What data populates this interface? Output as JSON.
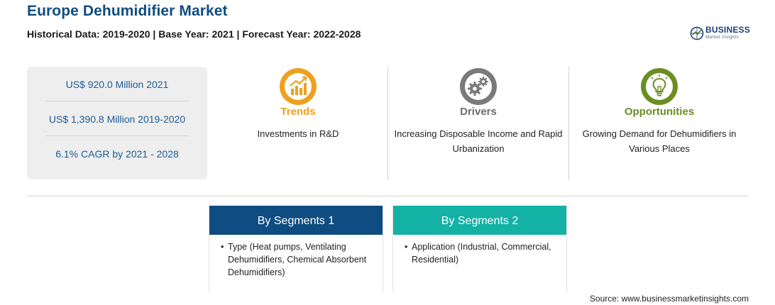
{
  "header": {
    "title": "Europe Dehumidifier Market",
    "subtitle": "Historical Data: 2019-2020 | Base Year: 2021 | Forecast Year: 2022-2028"
  },
  "logo": {
    "name": "BUSINESS",
    "tagline": "Market Insights",
    "icon": "globe-logo-icon"
  },
  "stats": [
    "US$ 920.0 Million 2021",
    "US$ 1,390.8 Million 2019-2020",
    "6.1% CAGR by 2021 - 2028"
  ],
  "columns": {
    "trends": {
      "title": "Trends",
      "text": "Investments in R&D",
      "icon": "trend-chart-icon",
      "color": "#f0a01e"
    },
    "drivers": {
      "title": "Drivers",
      "text": "Increasing Disposable Income and Rapid Urbanization",
      "icon": "gears-icon",
      "color": "#6d6d6d"
    },
    "opportunities": {
      "title": "Opportunities",
      "text": "Growing Demand for Dehumidifiers in Various Places",
      "icon": "lightbulb-icon",
      "color": "#6b8e23"
    }
  },
  "segments": [
    {
      "title": "By Segments 1",
      "bullet": "•",
      "text": "Type (Heat pumps, Ventilating Dehumidifiers, Chemical Absorbent Dehumidifiers)",
      "color": "#0f4c81"
    },
    {
      "title": "By Segments 2",
      "bullet": "•",
      "text": "Application (Industrial, Commercial, Residential)",
      "color": "#14b1a5"
    }
  ],
  "source": "Source: www.businessmarketinsights.com"
}
